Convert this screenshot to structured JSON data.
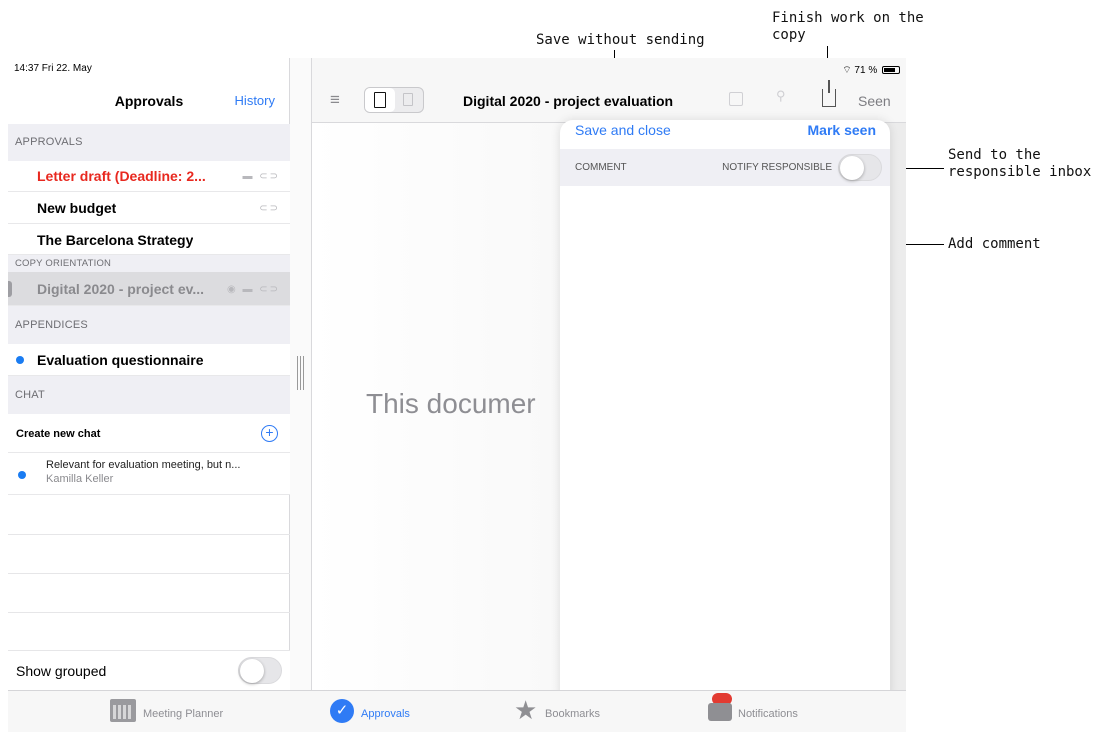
{
  "callouts": {
    "finish_work": "Finish work on the copy",
    "save_without_sending": "Save without sending",
    "send_to_inbox": "Send to the responsible inbox",
    "add_comment": "Add comment"
  },
  "status_bar": {
    "time": "14:37  Fri 22. May",
    "battery": "71 %"
  },
  "left_panel": {
    "title": "Approvals",
    "history_link": "History",
    "sections": {
      "approvals": "APPROVALS",
      "copy_orientation": "COPY ORIENTATION",
      "appendices": "APPENDICES",
      "chat": "CHAT"
    },
    "approvals_items": [
      {
        "label": "Letter draft (Deadline: 2...",
        "color": "#e8281f",
        "icons": "comment-icon, attachment-icon"
      },
      {
        "label": "New budget",
        "color": "#000000",
        "icons": "attachment-icon"
      },
      {
        "label": "The Barcelona Strategy",
        "color": "#000000",
        "icons": ""
      }
    ],
    "copy_orientation_item": {
      "label": "Digital 2020 - project ev...",
      "icons": "eye-icon, comment-icon, attachment-icon"
    },
    "appendices_item": {
      "label": "Evaluation questionnaire"
    },
    "chat": {
      "create_label": "Create new chat",
      "items": [
        {
          "text": "Relevant for evaluation meeting, but n...",
          "author": "Kamilla Keller"
        }
      ]
    },
    "show_grouped_label": "Show grouped",
    "show_grouped_on": false
  },
  "toolbar": {
    "title": "Digital 2020 - project evaluation",
    "seen": "Seen"
  },
  "document": {
    "message": "This documer"
  },
  "popover": {
    "save_close": "Save and close",
    "mark_seen": "Mark seen",
    "comment_label": "COMMENT",
    "notify_label": "NOTIFY RESPONSIBLE",
    "notify_on": false,
    "comment_value": ""
  },
  "tabbar": {
    "tabs": [
      {
        "label": "Meeting Planner",
        "color": "#8e8e93"
      },
      {
        "label": "Approvals",
        "color": "#2f7bf5"
      },
      {
        "label": "Bookmarks",
        "color": "#8e8e93"
      },
      {
        "label": "Notifications",
        "color": "#8e8e93"
      }
    ]
  },
  "colors": {
    "accent": "#2f7bf5",
    "deadline_red": "#e8281f",
    "unread_dot": "#1a7cf2"
  }
}
